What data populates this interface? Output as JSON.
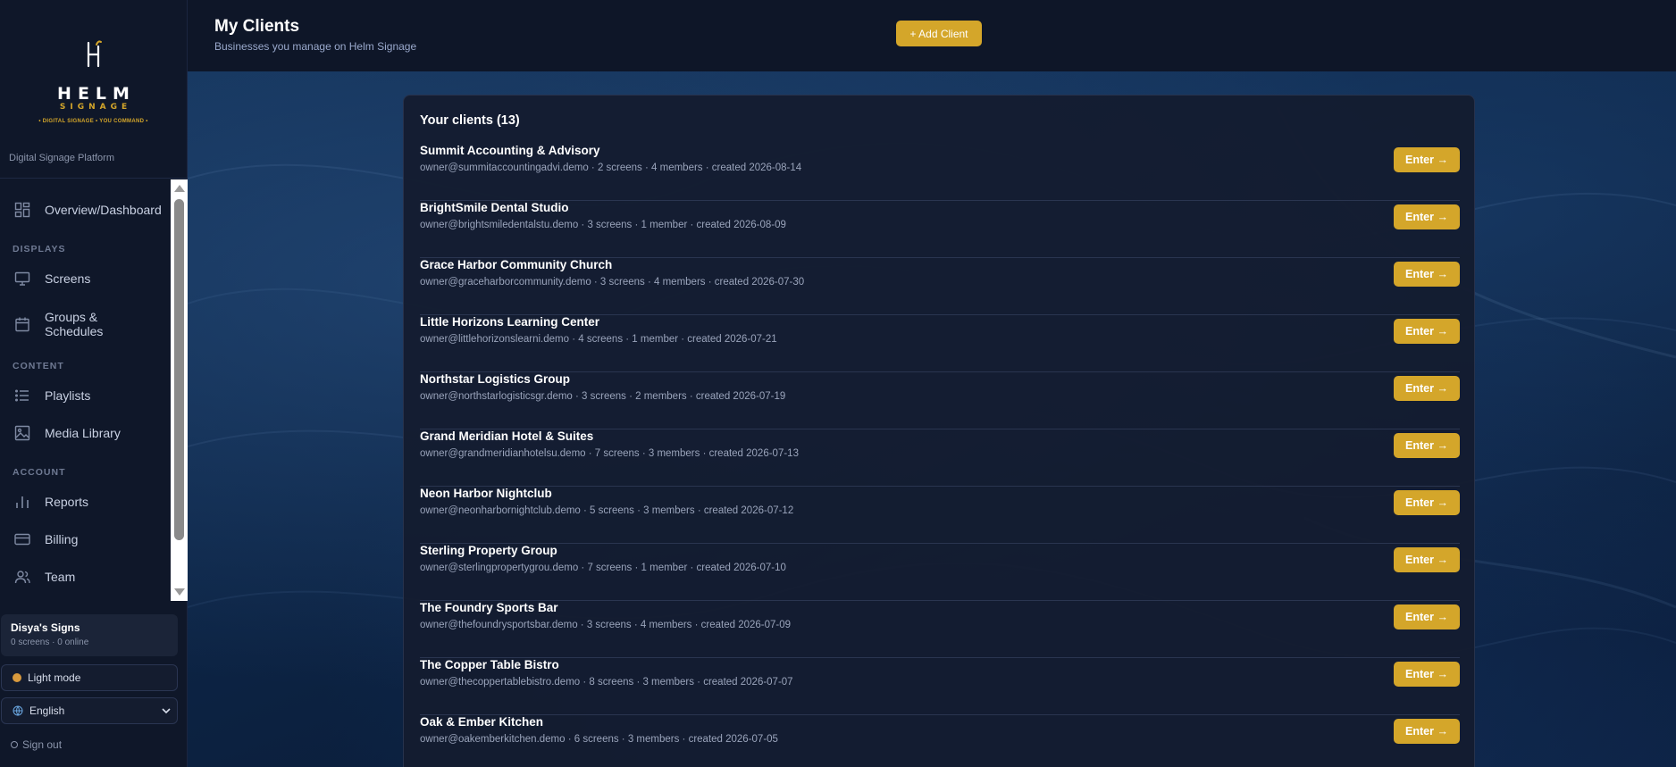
{
  "brand": {
    "logo_word": "HELM",
    "logo_subword": "SIGNAGE",
    "logo_tagline": "• DIGITAL SIGNAGE • YOU COMMAND •",
    "platform_label": "Digital Signage Platform",
    "accent_color": "#d4a62a"
  },
  "sidebar": {
    "items": [
      {
        "label": "Overview/Dashboard",
        "icon": "dashboard-icon"
      },
      {
        "section": "DISPLAYS"
      },
      {
        "label": "Screens",
        "icon": "monitor-icon"
      },
      {
        "label": "Groups & Schedules",
        "icon": "calendar-icon"
      },
      {
        "section": "CONTENT"
      },
      {
        "label": "Playlists",
        "icon": "list-icon"
      },
      {
        "label": "Media Library",
        "icon": "image-icon"
      },
      {
        "section": "ACCOUNT"
      },
      {
        "label": "Reports",
        "icon": "bar-chart-icon"
      },
      {
        "label": "Billing",
        "icon": "credit-card-icon"
      },
      {
        "label": "Team",
        "icon": "users-icon"
      }
    ],
    "org": {
      "name": "Disya's Signs",
      "stats": "0 screens · 0 online"
    },
    "mode_toggle": "Light mode",
    "language": "English",
    "sign_out": "Sign out"
  },
  "header": {
    "title": "My Clients",
    "subtitle": "Businesses you manage on Helm Signage",
    "add_client_label": "+ Add Client"
  },
  "clients_panel": {
    "title": "Your clients (13)",
    "enter_label": "Enter →",
    "clients": [
      {
        "name": "Summit Accounting & Advisory",
        "meta": "owner@summitaccountingadvi.demo · 2 screens · 4 members · created 2026-08-14"
      },
      {
        "name": "BrightSmile Dental Studio",
        "meta": "owner@brightsmiledentalstu.demo · 3 screens · 1 member · created 2026-08-09"
      },
      {
        "name": "Grace Harbor Community Church",
        "meta": "owner@graceharborcommunity.demo · 3 screens · 4 members · created 2026-07-30"
      },
      {
        "name": "Little Horizons Learning Center",
        "meta": "owner@littlehorizonslearni.demo · 4 screens · 1 member · created 2026-07-21"
      },
      {
        "name": "Northstar Logistics Group",
        "meta": "owner@northstarlogisticsgr.demo · 3 screens · 2 members · created 2026-07-19"
      },
      {
        "name": "Grand Meridian Hotel & Suites",
        "meta": "owner@grandmeridianhotelsu.demo · 7 screens · 3 members · created 2026-07-13"
      },
      {
        "name": "Neon Harbor Nightclub",
        "meta": "owner@neonharbornightclub.demo · 5 screens · 3 members · created 2026-07-12"
      },
      {
        "name": "Sterling Property Group",
        "meta": "owner@sterlingpropertygrou.demo · 7 screens · 1 member · created 2026-07-10"
      },
      {
        "name": "The Foundry Sports Bar",
        "meta": "owner@thefoundrysportsbar.demo · 3 screens · 4 members · created 2026-07-09"
      },
      {
        "name": "The Copper Table Bistro",
        "meta": "owner@thecoppertablebistro.demo · 8 screens · 3 members · created 2026-07-07"
      },
      {
        "name": "Oak & Ember Kitchen",
        "meta": "owner@oakemberkitchen.demo · 6 screens · 3 members · created 2026-07-05"
      }
    ]
  }
}
